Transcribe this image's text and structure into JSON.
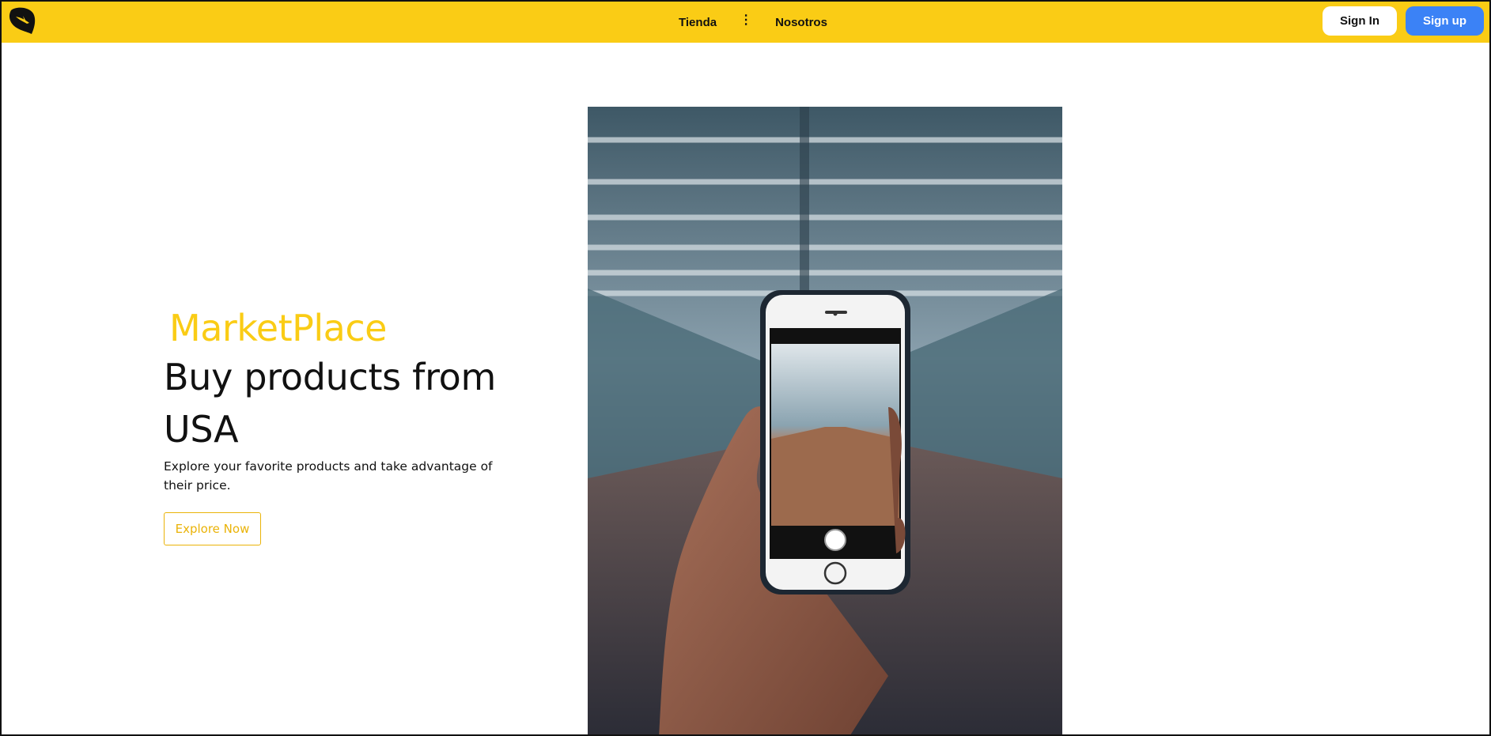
{
  "nav": {
    "links": [
      "Tienda",
      "Nosotros"
    ],
    "more_symbol": "⋮",
    "signin_label": "Sign In",
    "signup_label": "Sign up"
  },
  "hero": {
    "brand": "MarketPlace",
    "headline": "Buy products from USA",
    "subtext": "Explore your favorite products and take advantage of their price.",
    "cta_label": "Explore Now"
  },
  "colors": {
    "navbar": "#facc15",
    "brand": "#facc15",
    "signup": "#3b82f6",
    "cta": "#eab308"
  },
  "icons": {
    "logo": "bird-leaf-icon",
    "more": "more-vertical-icon"
  }
}
